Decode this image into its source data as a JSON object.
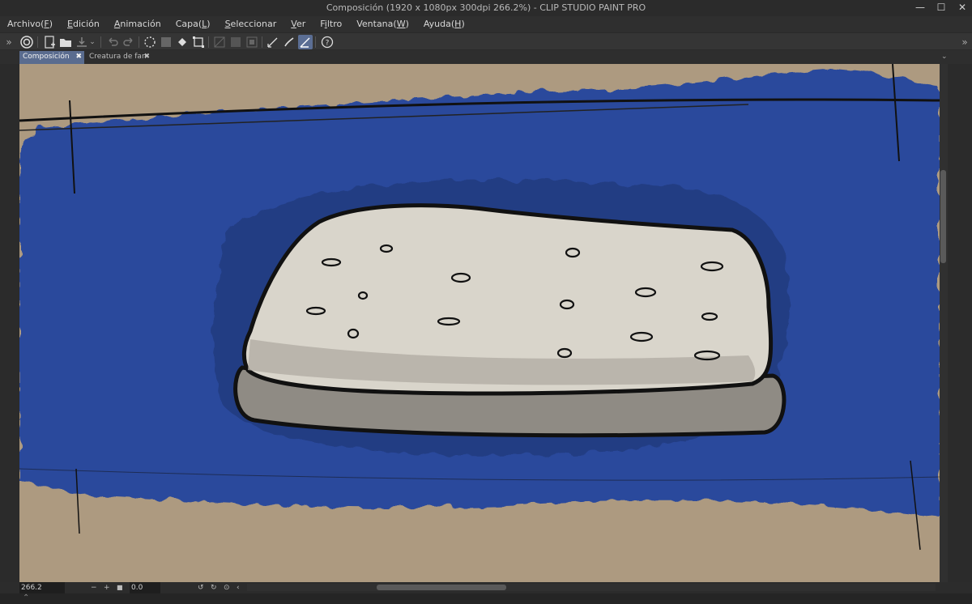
{
  "window": {
    "title": "Composición (1920 x 1080px 300dpi 266.2%)  - CLIP STUDIO PAINT PRO",
    "minimize": "—",
    "maximize": "☐",
    "close": "✕"
  },
  "menu": [
    {
      "pre": "Archivo(",
      "key": "F",
      "post": ")"
    },
    {
      "pre": "",
      "key": "E",
      "post": "dición"
    },
    {
      "pre": "",
      "key": "A",
      "post": "nimación"
    },
    {
      "pre": "Capa(",
      "key": "L",
      "post": ")"
    },
    {
      "pre": "",
      "key": "S",
      "post": "eleccionar"
    },
    {
      "pre": "",
      "key": "V",
      "post": "er"
    },
    {
      "pre": "F",
      "key": "i",
      "post": "ltro"
    },
    {
      "pre": "Ventana(",
      "key": "W",
      "post": ")"
    },
    {
      "pre": "Ayuda(",
      "key": "H",
      "post": ")"
    }
  ],
  "tabs": [
    {
      "label": "Composición",
      "close": "✖",
      "active": true
    },
    {
      "label": "Creatura de fan",
      "close": "✖",
      "active": false
    }
  ],
  "status": {
    "zoom": "266.2",
    "angle": "0.0"
  },
  "icons": {
    "expand_left": "»",
    "expand_right": "»",
    "collapse_up": "⌃"
  },
  "colors": {
    "background_paper": "#ad9a80",
    "brush_blue": "#2c4a9c",
    "mattress": "#d9d5cb",
    "outline": "#111111",
    "active_tab": "#5a6c8f"
  }
}
